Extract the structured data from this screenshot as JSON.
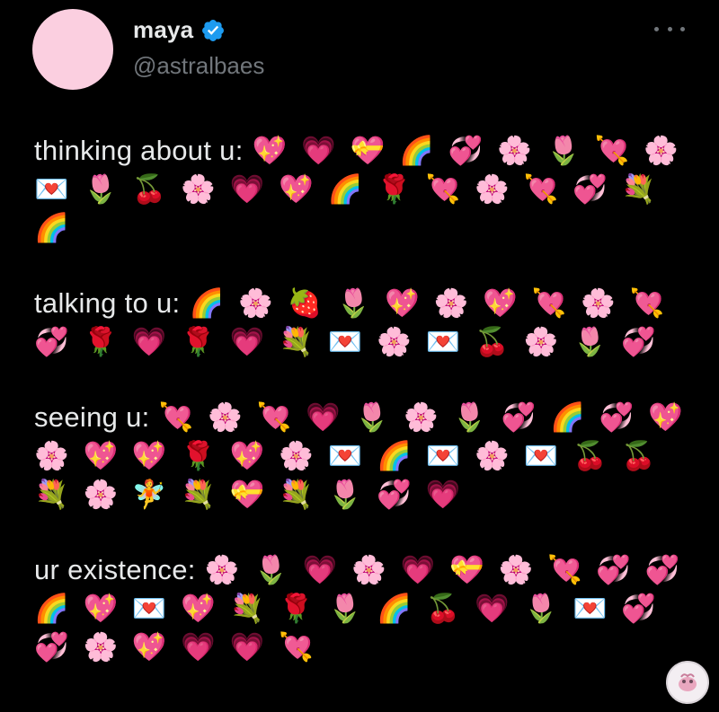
{
  "author": {
    "display_name": "maya",
    "handle": "@astralbaes",
    "verified": true,
    "avatar_color": "#fbcfe0"
  },
  "more_menu": {
    "icon": "more-horizontal-icon"
  },
  "tweet": {
    "stanzas": [
      {
        "label": "thinking about u:",
        "emojis": "💖 💗 💝 🌈 💞 🌸 🌷 💘 🌸 💌 🌷 🍒 🌸 💗 💖 🌈 🌹 💘 🌸 💘 💞 💐 🌈"
      },
      {
        "label": "talking to u:",
        "emojis": "🌈 🌸 🍓 🌷 💖 🌸 💖 💘 🌸 💘 💞 🌹 💗 🌹 💗 💐 💌 🌸 💌 🍒 🌸 🌷 💞"
      },
      {
        "label": "seeing u:",
        "emojis": "💘 🌸 💘 💗 🌷 🌸 🌷 💞 🌈 💞 💖 🌸 💖 💖 🌹 💖 🌸 💌 🌈 💌 🌸 💌 🍒 🍒 💐 🌸 🧚 💐 💝 💐 🌷 💞 💗"
      },
      {
        "label": "ur existence:",
        "emojis": "🌸 🌷 💗 🌸 💗 💝 🌸 💘 💞 💞 🌈 💖 💌 💖 💐 🌹 🌷 🌈 🍒 💗 🌷 💌 💞 💞 🌸 💖 💗 💗 💘"
      }
    ]
  },
  "floating_avatar": {
    "icon": "account-switcher-avatar-icon"
  }
}
